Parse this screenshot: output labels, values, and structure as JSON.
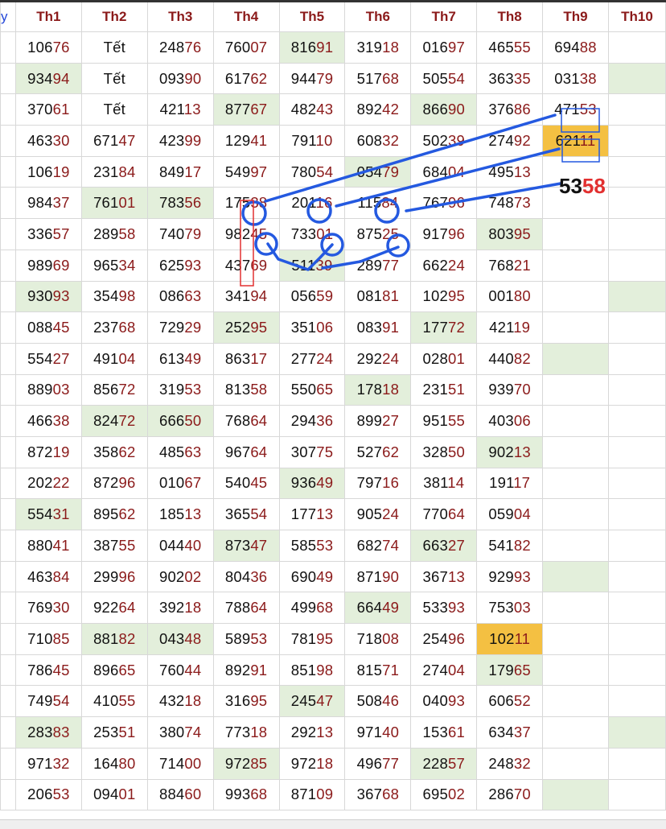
{
  "table": {
    "first_header": "y",
    "headers": [
      "Th1",
      "Th2",
      "Th3",
      "Th4",
      "Th5",
      "Th6",
      "Th7",
      "Th8",
      "Th9",
      "Th10"
    ],
    "rows": [
      [
        "10676",
        "Tết",
        "24876",
        "76007",
        "81691",
        "31918",
        "01697",
        "46555",
        "69488",
        ""
      ],
      [
        "93494",
        "Tết",
        "09390",
        "61762",
        "94479",
        "51768",
        "50554",
        "36335",
        "03138",
        ""
      ],
      [
        "37061",
        "Tết",
        "42113",
        "87767",
        "48243",
        "89242",
        "86690",
        "37686",
        "47153",
        ""
      ],
      [
        "46330",
        "67147",
        "42399",
        "12941",
        "79110",
        "60832",
        "50239",
        "27492",
        "62111",
        ""
      ],
      [
        "10619",
        "23184",
        "84917",
        "54997",
        "78054",
        "05479",
        "68404",
        "49513",
        "",
        ""
      ],
      [
        "98437",
        "76101",
        "78356",
        "17538",
        "20116",
        "11584",
        "76796",
        "74873",
        "",
        ""
      ],
      [
        "33657",
        "28958",
        "74079",
        "98245",
        "73301",
        "87525",
        "91796",
        "80395",
        "",
        ""
      ],
      [
        "98969",
        "96534",
        "62593",
        "43769",
        "51139",
        "28977",
        "66224",
        "76821",
        "",
        ""
      ],
      [
        "93093",
        "35498",
        "08663",
        "34194",
        "05659",
        "08181",
        "10295",
        "00180",
        "",
        ""
      ],
      [
        "08845",
        "23768",
        "72929",
        "25295",
        "35106",
        "08391",
        "17772",
        "42119",
        "",
        ""
      ],
      [
        "55427",
        "49104",
        "61349",
        "86317",
        "27724",
        "29224",
        "02801",
        "44082",
        "",
        ""
      ],
      [
        "88903",
        "85672",
        "31953",
        "81358",
        "55065",
        "17818",
        "23151",
        "93970",
        "",
        ""
      ],
      [
        "46638",
        "82472",
        "66650",
        "76864",
        "29436",
        "89927",
        "95155",
        "40306",
        "",
        ""
      ],
      [
        "87219",
        "35862",
        "48563",
        "96764",
        "30775",
        "52762",
        "32850",
        "90213",
        "",
        ""
      ],
      [
        "20222",
        "87296",
        "01067",
        "54045",
        "93649",
        "79716",
        "38114",
        "19117",
        "",
        ""
      ],
      [
        "55431",
        "89562",
        "18513",
        "36554",
        "17713",
        "90524",
        "77064",
        "05904",
        "",
        ""
      ],
      [
        "88041",
        "38755",
        "04440",
        "87347",
        "58553",
        "68274",
        "66327",
        "54182",
        "",
        ""
      ],
      [
        "46384",
        "29996",
        "90202",
        "80436",
        "69049",
        "87190",
        "36713",
        "92993",
        "",
        ""
      ],
      [
        "76930",
        "92264",
        "39218",
        "78864",
        "49968",
        "66449",
        "53393",
        "75303",
        "",
        ""
      ],
      [
        "71085",
        "88182",
        "04348",
        "58953",
        "78195",
        "71808",
        "25496",
        "10211",
        "",
        ""
      ],
      [
        "78645",
        "89665",
        "76044",
        "89291",
        "85198",
        "81571",
        "27404",
        "17965",
        "",
        ""
      ],
      [
        "74954",
        "41055",
        "43218",
        "31695",
        "24547",
        "50846",
        "04093",
        "60652",
        "",
        ""
      ],
      [
        "28383",
        "25351",
        "38074",
        "77318",
        "29213",
        "97140",
        "15361",
        "63437",
        "",
        ""
      ],
      [
        "97132",
        "16480",
        "71400",
        "97285",
        "97218",
        "49677",
        "22857",
        "24832",
        "",
        ""
      ],
      [
        "20653",
        "09401",
        "88460",
        "99368",
        "87109",
        "36768",
        "69502",
        "28670",
        "",
        ""
      ]
    ],
    "green_cells": [
      [
        0,
        4
      ],
      [
        1,
        0
      ],
      [
        1,
        9
      ],
      [
        2,
        3
      ],
      [
        2,
        6
      ],
      [
        4,
        5
      ],
      [
        5,
        1
      ],
      [
        5,
        2
      ],
      [
        6,
        7
      ],
      [
        7,
        4
      ],
      [
        8,
        0
      ],
      [
        8,
        9
      ],
      [
        9,
        3
      ],
      [
        9,
        6
      ],
      [
        10,
        8
      ],
      [
        11,
        5
      ],
      [
        12,
        1
      ],
      [
        12,
        2
      ],
      [
        13,
        7
      ],
      [
        14,
        4
      ],
      [
        15,
        0
      ],
      [
        16,
        3
      ],
      [
        16,
        6
      ],
      [
        17,
        8
      ],
      [
        18,
        5
      ],
      [
        19,
        1
      ],
      [
        19,
        2
      ],
      [
        20,
        7
      ],
      [
        21,
        4
      ],
      [
        22,
        0
      ],
      [
        22,
        9
      ],
      [
        23,
        3
      ],
      [
        23,
        6
      ],
      [
        24,
        8
      ]
    ],
    "orange_cells": [
      [
        3,
        8
      ],
      [
        19,
        7
      ]
    ]
  },
  "annotation": {
    "prediction_main": "53",
    "prediction_tail": "58",
    "line_color": "#2459e0",
    "marker_color": "#e23030"
  },
  "colors": {
    "header_text": "#8b1a1a",
    "tail_digits": "#8b1a1a",
    "green_bg": "#e3efdb",
    "orange_bg": "#f4c042"
  }
}
